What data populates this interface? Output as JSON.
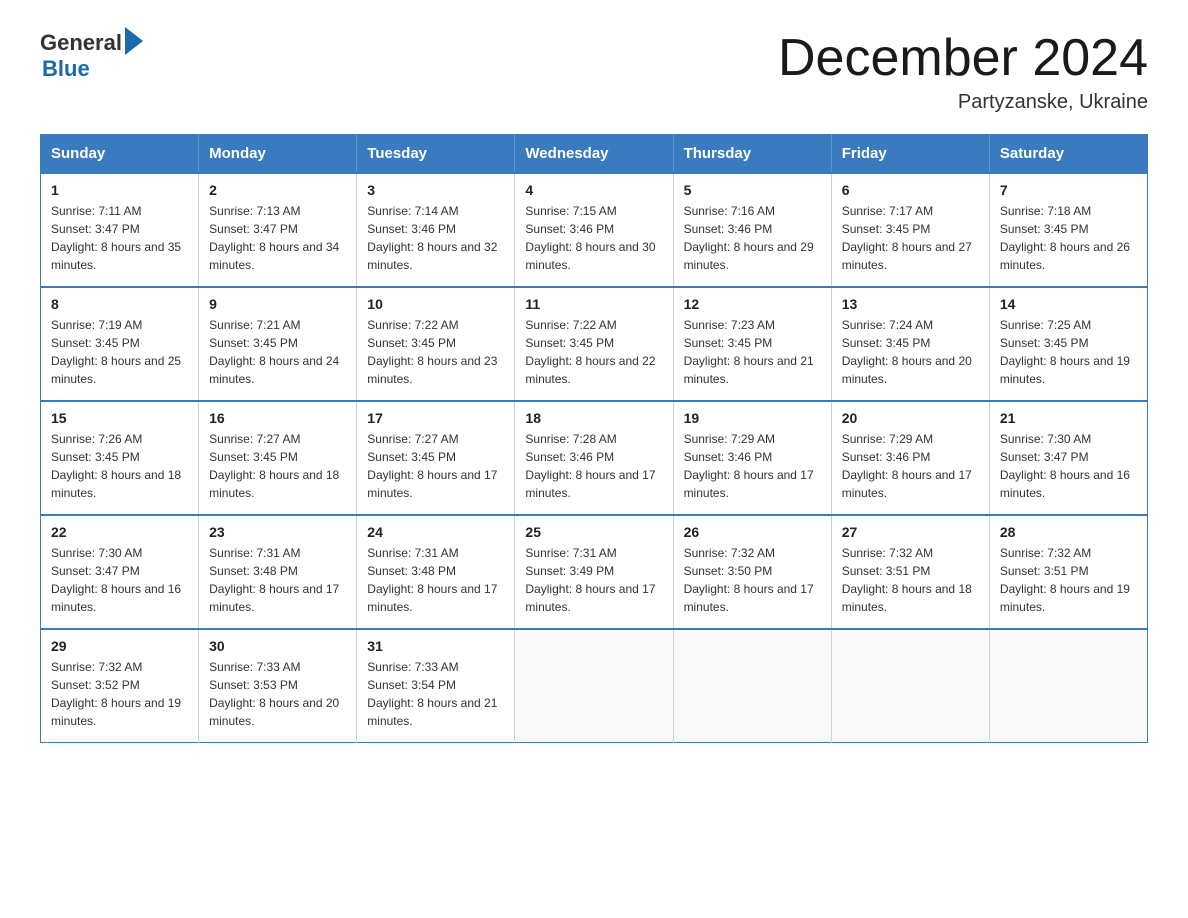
{
  "header": {
    "logo_general": "General",
    "logo_blue": "Blue",
    "title": "December 2024",
    "location": "Partyzanske, Ukraine"
  },
  "days_of_week": [
    "Sunday",
    "Monday",
    "Tuesday",
    "Wednesday",
    "Thursday",
    "Friday",
    "Saturday"
  ],
  "weeks": [
    [
      {
        "day": "1",
        "sunrise": "7:11 AM",
        "sunset": "3:47 PM",
        "daylight": "8 hours and 35 minutes."
      },
      {
        "day": "2",
        "sunrise": "7:13 AM",
        "sunset": "3:47 PM",
        "daylight": "8 hours and 34 minutes."
      },
      {
        "day": "3",
        "sunrise": "7:14 AM",
        "sunset": "3:46 PM",
        "daylight": "8 hours and 32 minutes."
      },
      {
        "day": "4",
        "sunrise": "7:15 AM",
        "sunset": "3:46 PM",
        "daylight": "8 hours and 30 minutes."
      },
      {
        "day": "5",
        "sunrise": "7:16 AM",
        "sunset": "3:46 PM",
        "daylight": "8 hours and 29 minutes."
      },
      {
        "day": "6",
        "sunrise": "7:17 AM",
        "sunset": "3:45 PM",
        "daylight": "8 hours and 27 minutes."
      },
      {
        "day": "7",
        "sunrise": "7:18 AM",
        "sunset": "3:45 PM",
        "daylight": "8 hours and 26 minutes."
      }
    ],
    [
      {
        "day": "8",
        "sunrise": "7:19 AM",
        "sunset": "3:45 PM",
        "daylight": "8 hours and 25 minutes."
      },
      {
        "day": "9",
        "sunrise": "7:21 AM",
        "sunset": "3:45 PM",
        "daylight": "8 hours and 24 minutes."
      },
      {
        "day": "10",
        "sunrise": "7:22 AM",
        "sunset": "3:45 PM",
        "daylight": "8 hours and 23 minutes."
      },
      {
        "day": "11",
        "sunrise": "7:22 AM",
        "sunset": "3:45 PM",
        "daylight": "8 hours and 22 minutes."
      },
      {
        "day": "12",
        "sunrise": "7:23 AM",
        "sunset": "3:45 PM",
        "daylight": "8 hours and 21 minutes."
      },
      {
        "day": "13",
        "sunrise": "7:24 AM",
        "sunset": "3:45 PM",
        "daylight": "8 hours and 20 minutes."
      },
      {
        "day": "14",
        "sunrise": "7:25 AM",
        "sunset": "3:45 PM",
        "daylight": "8 hours and 19 minutes."
      }
    ],
    [
      {
        "day": "15",
        "sunrise": "7:26 AM",
        "sunset": "3:45 PM",
        "daylight": "8 hours and 18 minutes."
      },
      {
        "day": "16",
        "sunrise": "7:27 AM",
        "sunset": "3:45 PM",
        "daylight": "8 hours and 18 minutes."
      },
      {
        "day": "17",
        "sunrise": "7:27 AM",
        "sunset": "3:45 PM",
        "daylight": "8 hours and 17 minutes."
      },
      {
        "day": "18",
        "sunrise": "7:28 AM",
        "sunset": "3:46 PM",
        "daylight": "8 hours and 17 minutes."
      },
      {
        "day": "19",
        "sunrise": "7:29 AM",
        "sunset": "3:46 PM",
        "daylight": "8 hours and 17 minutes."
      },
      {
        "day": "20",
        "sunrise": "7:29 AM",
        "sunset": "3:46 PM",
        "daylight": "8 hours and 17 minutes."
      },
      {
        "day": "21",
        "sunrise": "7:30 AM",
        "sunset": "3:47 PM",
        "daylight": "8 hours and 16 minutes."
      }
    ],
    [
      {
        "day": "22",
        "sunrise": "7:30 AM",
        "sunset": "3:47 PM",
        "daylight": "8 hours and 16 minutes."
      },
      {
        "day": "23",
        "sunrise": "7:31 AM",
        "sunset": "3:48 PM",
        "daylight": "8 hours and 17 minutes."
      },
      {
        "day": "24",
        "sunrise": "7:31 AM",
        "sunset": "3:48 PM",
        "daylight": "8 hours and 17 minutes."
      },
      {
        "day": "25",
        "sunrise": "7:31 AM",
        "sunset": "3:49 PM",
        "daylight": "8 hours and 17 minutes."
      },
      {
        "day": "26",
        "sunrise": "7:32 AM",
        "sunset": "3:50 PM",
        "daylight": "8 hours and 17 minutes."
      },
      {
        "day": "27",
        "sunrise": "7:32 AM",
        "sunset": "3:51 PM",
        "daylight": "8 hours and 18 minutes."
      },
      {
        "day": "28",
        "sunrise": "7:32 AM",
        "sunset": "3:51 PM",
        "daylight": "8 hours and 19 minutes."
      }
    ],
    [
      {
        "day": "29",
        "sunrise": "7:32 AM",
        "sunset": "3:52 PM",
        "daylight": "8 hours and 19 minutes."
      },
      {
        "day": "30",
        "sunrise": "7:33 AM",
        "sunset": "3:53 PM",
        "daylight": "8 hours and 20 minutes."
      },
      {
        "day": "31",
        "sunrise": "7:33 AM",
        "sunset": "3:54 PM",
        "daylight": "8 hours and 21 minutes."
      },
      null,
      null,
      null,
      null
    ]
  ]
}
